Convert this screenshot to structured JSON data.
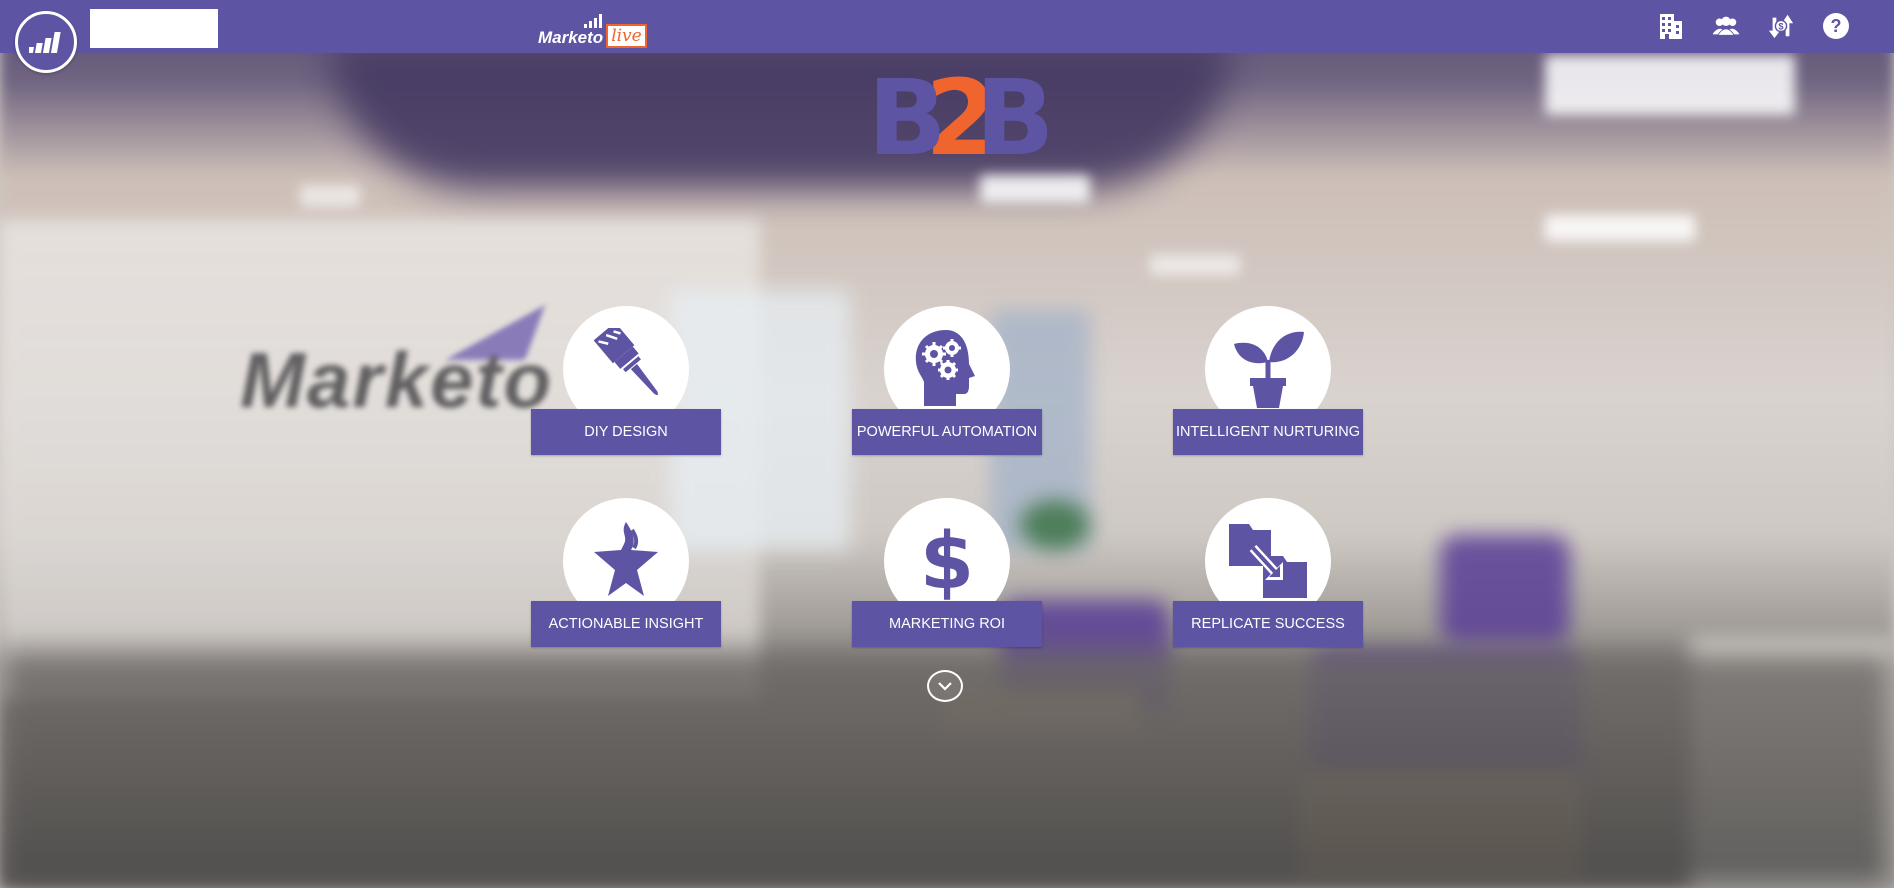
{
  "header": {
    "brand_logo_icon": "marketo-bars-icon",
    "search": {
      "value": "",
      "placeholder": ""
    },
    "product_logo": {
      "wordmark": "Marketo",
      "badge": "live"
    },
    "icons": [
      "building-icon",
      "people-icon",
      "money-exchange-icon",
      "help-icon"
    ]
  },
  "hero": {
    "logo": {
      "left": "B",
      "middle": "2",
      "right": "B"
    },
    "colors": {
      "primary": "#5d54a4",
      "accent": "#f0642e"
    }
  },
  "features": [
    {
      "label": "DIY DESIGN",
      "icon": "paintbrush-icon"
    },
    {
      "label": "POWERFUL AUTOMATION",
      "icon": "head-gears-icon"
    },
    {
      "label": "INTELLIGENT NURTURING",
      "icon": "plant-icon"
    },
    {
      "label": "ACTIONABLE INSIGHT",
      "icon": "flaming-star-icon"
    },
    {
      "label": "MARKETING ROI",
      "icon": "dollar-icon"
    },
    {
      "label": "REPLICATE SUCCESS",
      "icon": "folder-copy-icon"
    }
  ],
  "scroll_icon": "chevron-down-icon"
}
